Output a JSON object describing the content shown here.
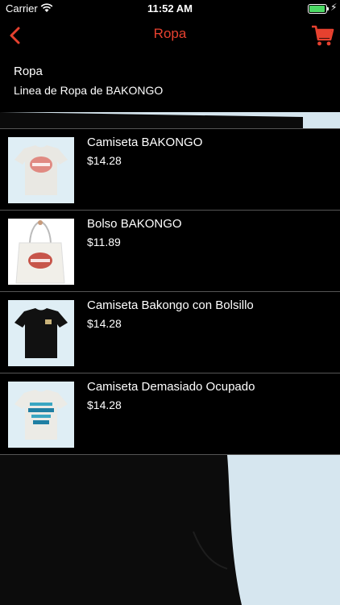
{
  "status_bar": {
    "carrier": "Carrier",
    "time": "11:52 AM"
  },
  "nav": {
    "title": "Ropa",
    "back_icon": "chevron-left-icon",
    "cart_icon": "shopping-cart-icon",
    "accent_color": "#e6412f"
  },
  "header": {
    "title": "Ropa",
    "subtitle": "Linea de Ropa de BAKONGO"
  },
  "products": [
    {
      "name": "Camiseta BAKONGO",
      "price": "$14.28",
      "thumb": "white-tshirt-red-logo"
    },
    {
      "name": "Bolso BAKONGO",
      "price": "$11.89",
      "thumb": "tote-bag"
    },
    {
      "name": "Camiseta Bakongo con Bolsillo",
      "price": "$14.28",
      "thumb": "black-tshirt-pocket"
    },
    {
      "name": "Camiseta Demasiado Ocupado",
      "price": "$14.28",
      "thumb": "white-tshirt-blue-text"
    }
  ]
}
